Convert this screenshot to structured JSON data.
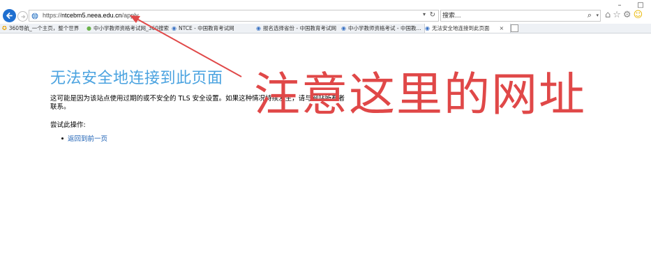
{
  "browser": {
    "window_controls": {
      "minimize": "–",
      "maximize": "□"
    },
    "address_bar": {
      "url_prefix": "https://",
      "url_host": "ntcebm5.neea.edu.cn",
      "url_path": "/apply"
    },
    "search": {
      "placeholder": "搜索..."
    },
    "tabs": [
      {
        "label": "360导航_一个主页，整个世界"
      },
      {
        "label": "中小学教师资格考试网_360搜索"
      },
      {
        "label": "NTCE - 中国教育考试网"
      },
      {
        "label": "报名选择省份 - 中国教育考试网"
      },
      {
        "label": "中小学教师资格考试 - 中国教..."
      },
      {
        "label": "无法安全地连接到此页面",
        "close": "×",
        "active": true
      }
    ]
  },
  "page": {
    "title": "无法安全地连接到此页面",
    "description": "这可能是因为该站点使用过期的或不安全的 TLS 安全设置。如果这种情况持续发生，请与网站所有者联系。",
    "try_label": "尝试此操作:",
    "back_link": "返回到前一页"
  },
  "annotation": {
    "text": "注意这里的网址",
    "color": "#e04848"
  },
  "colors": {
    "accent": "#1f6fd0",
    "title": "#4ba3e0",
    "link": "#1a5fb4"
  }
}
